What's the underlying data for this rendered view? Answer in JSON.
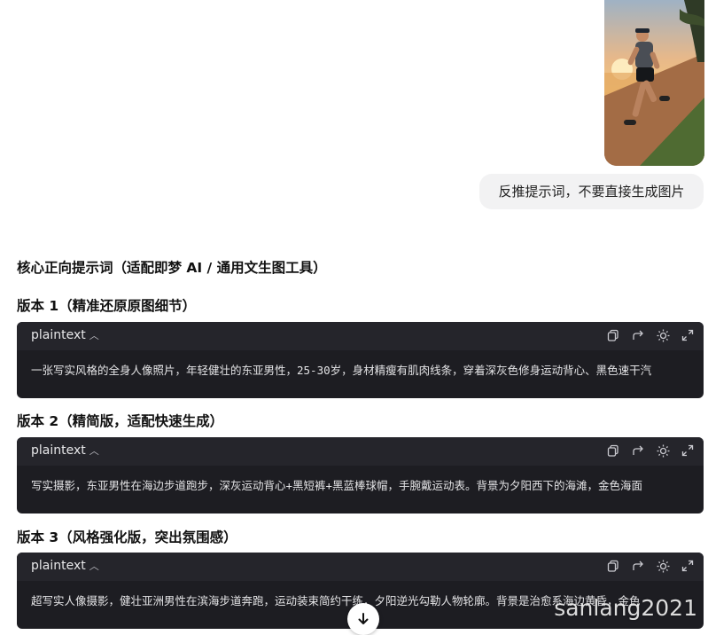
{
  "chat": {
    "user_message": "反推提示词，不要直接生成图片"
  },
  "response": {
    "section_title": "核心正向提示词（适配即梦 AI / 通用文生图工具）",
    "versions": [
      {
        "heading": "版本 1（精准还原原图细节）",
        "lang": "plaintext",
        "code": "一张写实风格的全身人像照片，年轻健壮的东亚男性，25-30岁，身材精瘦有肌肉线条，穿着深灰色修身运动背心、黑色速干汽"
      },
      {
        "heading": "版本 2（精简版，适配快速生成）",
        "lang": "plaintext",
        "code": "写实摄影，东亚男性在海边步道跑步，深灰运动背心+黑短裤+黑蓝棒球帽，手腕戴运动表。背景为夕阳西下的海滩，金色海面"
      },
      {
        "heading": "版本 3（风格强化版，突出氛围感）",
        "lang": "plaintext",
        "code": "超写实人像摄影，健壮亚洲男性在滨海步道奔跑，运动装束简约干练，夕阳逆光勾勒人物轮廓。背景是治愈系海边黄昏，金色"
      }
    ]
  },
  "icons": {
    "copy": "copy-icon",
    "share": "share-icon",
    "theme": "sun-icon",
    "expand": "expand-icon",
    "collapse": "chevron-up-icon",
    "scroll": "arrow-down-icon"
  },
  "watermark": "sanlang2021",
  "colors": {
    "code_bg": "#1d1d22",
    "code_header_bg": "#25252b",
    "user_bubble_bg": "#f2f2f3"
  }
}
